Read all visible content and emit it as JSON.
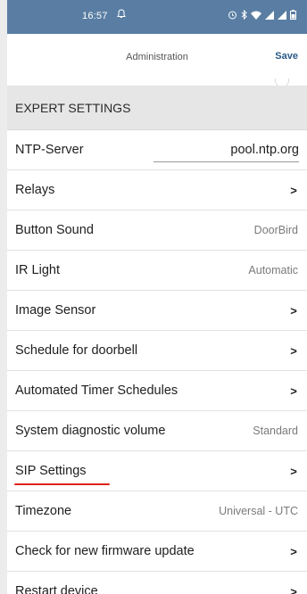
{
  "status_bar": {
    "time": "16:57",
    "background": "#5a7ea3"
  },
  "header": {
    "title": "Administration",
    "save_label": "Save"
  },
  "section": {
    "title": "EXPERT SETTINGS"
  },
  "ntp": {
    "label": "NTP-Server",
    "value": "pool.ntp.org"
  },
  "rows": {
    "relays": {
      "label": "Relays",
      "icon": "chevron-right-icon"
    },
    "button_sound": {
      "label": "Button Sound",
      "value": "DoorBird"
    },
    "ir_light": {
      "label": "IR Light",
      "value": "Automatic"
    },
    "image_sensor": {
      "label": "Image Sensor",
      "icon": "chevron-right-icon"
    },
    "schedule_doorbell": {
      "label": "Schedule for doorbell",
      "icon": "chevron-right-icon"
    },
    "automated_timer": {
      "label": "Automated Timer Schedules",
      "icon": "chevron-right-icon"
    },
    "diag_volume": {
      "label": "System diagnostic volume",
      "value": "Standard"
    },
    "sip_settings": {
      "label": "SIP Settings",
      "icon": "chevron-right-icon",
      "highlight_color": "#e0221b"
    },
    "timezone": {
      "label": "Timezone",
      "value": "Universal - UTC"
    },
    "firmware": {
      "label": "Check for new firmware update",
      "icon": "chevron-right-icon"
    },
    "restart": {
      "label": "Restart device",
      "icon": "chevron-right-icon"
    }
  },
  "chevron_glyph": ">"
}
